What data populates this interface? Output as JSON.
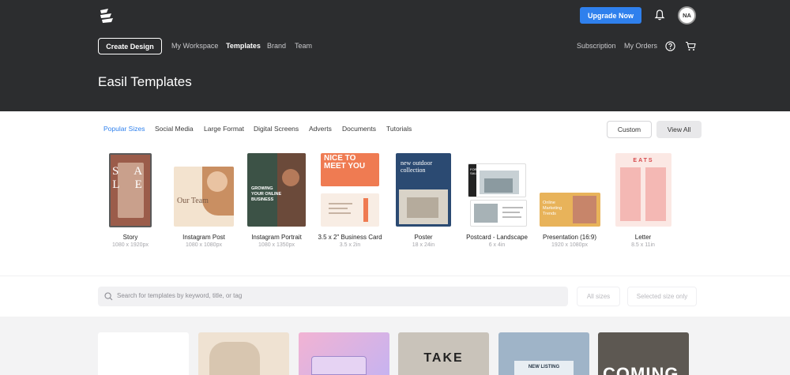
{
  "header": {
    "upgrade_label": "Upgrade Now",
    "avatar_initials": "NA",
    "create_label": "Create Design",
    "nav": [
      {
        "label": "My Workspace",
        "active": false
      },
      {
        "label": "Templates",
        "active": true
      },
      {
        "label": "Brand",
        "active": false
      },
      {
        "label": "Team",
        "active": false
      }
    ],
    "right_nav": [
      {
        "label": "Subscription"
      },
      {
        "label": "My Orders"
      }
    ],
    "page_title": "Easil Templates"
  },
  "category_tabs": [
    {
      "label": "Popular Sizes",
      "active": true
    },
    {
      "label": "Social Media",
      "active": false
    },
    {
      "label": "Large Format",
      "active": false
    },
    {
      "label": "Digital Screens",
      "active": false
    },
    {
      "label": "Adverts",
      "active": false
    },
    {
      "label": "Documents",
      "active": false
    },
    {
      "label": "Tutorials",
      "active": false
    }
  ],
  "panel_buttons": {
    "custom_label": "Custom",
    "view_all_label": "View All"
  },
  "sizes": [
    {
      "label": "Story",
      "dims": "1080 x 1920px",
      "thumb_text": "S A L E"
    },
    {
      "label": "Instagram Post",
      "dims": "1080 x 1080px",
      "thumb_text": "Our Team"
    },
    {
      "label": "Instagram Portrait",
      "dims": "1080 x 1350px",
      "thumb_text": "GROWING YOUR ONLINE BUSINESS"
    },
    {
      "label": "3.5 x 2\" Business Card",
      "dims": "3.5 x 2in",
      "thumb_text": "NICE TO MEET YOU"
    },
    {
      "label": "Poster",
      "dims": "18 x 24in",
      "thumb_text": "new outdoor collection"
    },
    {
      "label": "Postcard - Landscape",
      "dims": "6 x 4in",
      "thumb_text": "FOR SALE"
    },
    {
      "label": "Presentation (16:9)",
      "dims": "1920 x 1080px",
      "thumb_text": "Online Marketing Trends"
    },
    {
      "label": "Letter",
      "dims": "8.5 x 11in",
      "thumb_text": "EATS"
    }
  ],
  "search": {
    "placeholder": "Search for templates by keyword, title, or tag",
    "all_sizes_label": "All sizes",
    "selected_size_label": "Selected size only"
  },
  "gallery": [
    {
      "text": ""
    },
    {
      "text": ""
    },
    {
      "text": ""
    },
    {
      "text": "TAKE"
    },
    {
      "text": "NEW LISTING"
    },
    {
      "text": "COMING"
    }
  ],
  "colors": {
    "header_bg": "#2c2d2f",
    "accent": "#2f80ed"
  }
}
